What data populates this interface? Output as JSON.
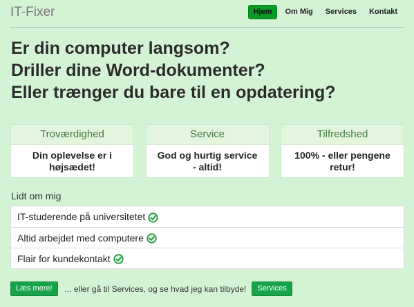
{
  "header": {
    "brand": "IT-Fixer",
    "nav": [
      {
        "label": "Hjem",
        "active": true
      },
      {
        "label": "Om Mig",
        "active": false
      },
      {
        "label": "Services",
        "active": false
      },
      {
        "label": "Kontakt",
        "active": false
      }
    ]
  },
  "headline": {
    "lines": [
      "Er din computer langsom?",
      "Driller dine Word-dokumenter?",
      "Eller trænger du bare til en opdatering?"
    ]
  },
  "cards": [
    {
      "title": "Troværdighed",
      "body": "Din oplevelse er i højsædet!"
    },
    {
      "title": "Service",
      "body": "God og hurtig service - altid!"
    },
    {
      "title": "Tilfredshed",
      "body": "100% - eller pengene retur!"
    }
  ],
  "about": {
    "label": "Lidt om mig",
    "items": [
      {
        "text": "IT-studerende på universitetet",
        "icon": "check-circle-icon"
      },
      {
        "text": "Altid arbejdet med computere",
        "icon": "check-circle-icon"
      },
      {
        "text": "Flair for kundekontakt",
        "icon": "check-circle-icon"
      }
    ]
  },
  "footer": {
    "read_more_label": "Læs mere!",
    "text": "... eller gå til Services, og se hvad jeg kan tilbyde!",
    "services_label": "Services"
  },
  "colors": {
    "background": "#d4f3d4",
    "accent": "#17a34a",
    "card_title": "#3d7a3d"
  }
}
